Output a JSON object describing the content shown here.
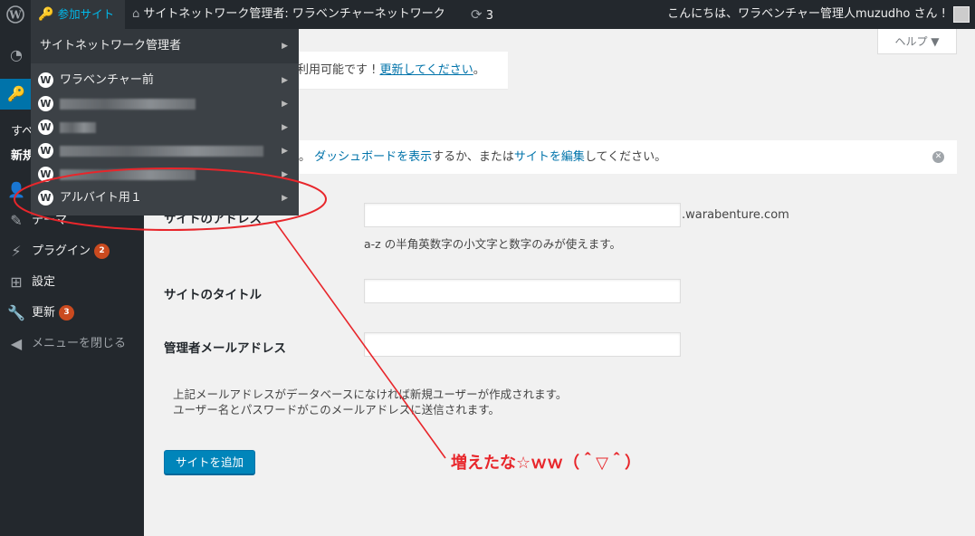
{
  "adminbar": {
    "my_sites": "参加サイト",
    "network_title": "サイトネットワーク管理者: ワラベンチャーネットワーク",
    "updates_count": "3",
    "greeting": "こんにちは、ワラベンチャー管理人muzudho さん !"
  },
  "dropdown": {
    "network_admin": "サイトネットワーク管理者",
    "sites": [
      {
        "label": "ワラベンチャー前",
        "blurred": false
      },
      {
        "label": "",
        "blurred": true
      },
      {
        "label": "",
        "blurred": true
      },
      {
        "label": "",
        "blurred": true
      },
      {
        "label": "",
        "blurred": true
      },
      {
        "label": "アルバイト用１",
        "blurred": false
      }
    ]
  },
  "menu": {
    "sub_all": "すべ",
    "sub_new": "新規",
    "themes": "テーマ",
    "plugins": "プラグイン",
    "plugins_badge": "2",
    "settings": "設定",
    "updates": "更新",
    "updates_badge": "3",
    "collapse": "メニューを閉じる"
  },
  "help_tab": "ヘルプ ▼",
  "update_nag": {
    "prefix": "利用可能です ! ",
    "link": "更新してください",
    "suffix": "。"
  },
  "notice": {
    "prefix": "。",
    "link1": "ダッシュボードを表示",
    "middle": "するか、または",
    "link2": "サイトを編集",
    "suffix": "してください。"
  },
  "form": {
    "site_address_label": "サイトのアドレス",
    "domain_suffix": ".warabenture.com",
    "address_description": "a-z の半角英数字の小文字と数字のみが使えます。",
    "site_title_label": "サイトのタイトル",
    "admin_email_label": "管理者メールアドレス",
    "email_note_line1": "上記メールアドレスがデータベースになければ新規ユーザーが作成されます。",
    "email_note_line2": "ユーザー名とパスワードがこのメールアドレスに送信されます。",
    "submit": "サイトを追加"
  },
  "annotation": "増えたな☆ｗｗ（＾▽＾）",
  "colors": {
    "accent": "#0073aa",
    "annotation": "#e8262b",
    "adminbar": "#23282d"
  }
}
